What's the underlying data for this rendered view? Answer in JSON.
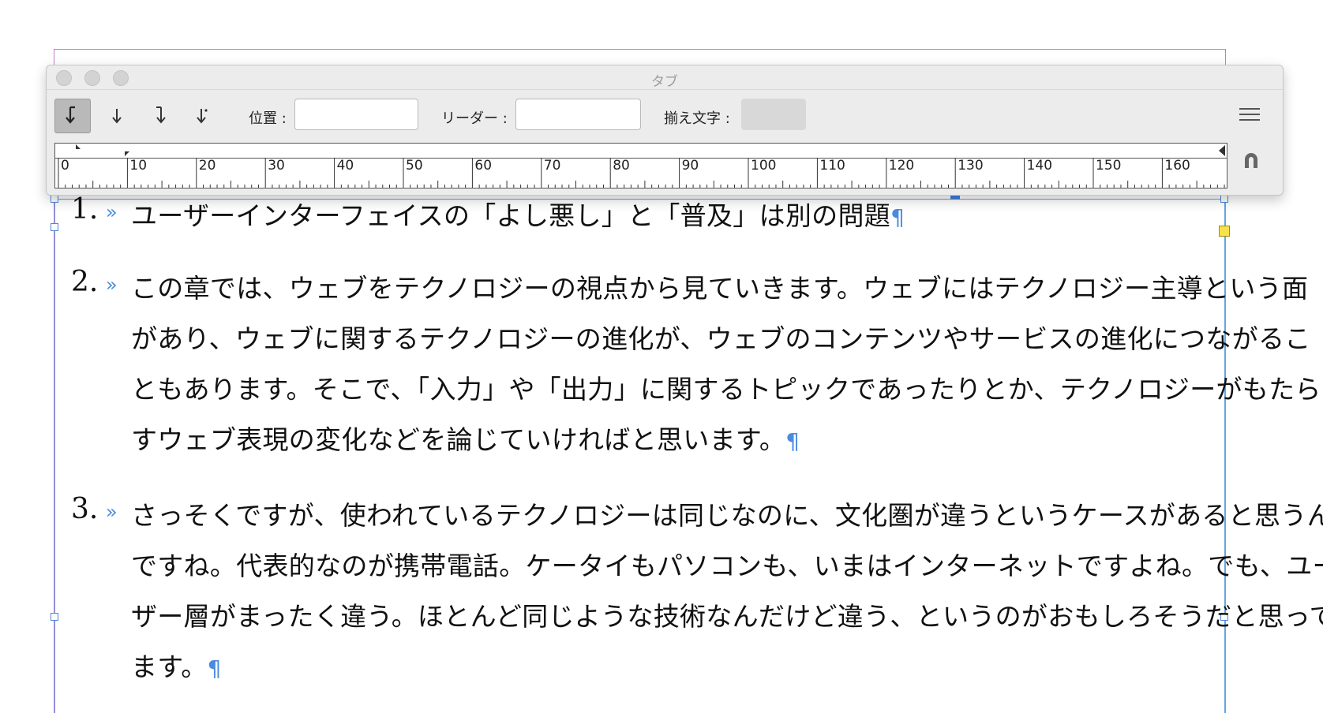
{
  "document": {
    "paragraphs": [
      {
        "number": "1.",
        "lines": [
          "ユーザーインターフェイスの「よし悪し」と「普及」は別の問題"
        ]
      },
      {
        "number": "2.",
        "lines": [
          "この章では、ウェブをテクノロジーの視点から見ていきます。ウェブにはテクノロジー主導という面",
          "があり、ウェブに関するテクノロジーの進化が、ウェブのコンテンツやサービスの進化につながるこ",
          "ともあります。そこで、「入力」や「出力」に関するトピックであったりとか、テクノロジーがもたら",
          "すウェブ表現の変化などを論じていければと思います。"
        ]
      },
      {
        "number": "3.",
        "lines": [
          "さっそくですが、使われているテクノロジーは同じなのに、文化圏が違うというケースがあると思うん",
          "ですね。代表的なのが携帯電話。ケータイもパソコンも、いまはインターネットですよね。でも、ユー",
          "ザー層がまったく違う。ほとんど同じような技術なんだけど違う、というのがおもしろそうだと思ってい",
          "ます。"
        ]
      }
    ],
    "tab_mark": "»",
    "pilcrow": "¶"
  },
  "panel": {
    "title": "タブ",
    "position_label": "位置 :",
    "position_value": "",
    "leader_label": "リーダー :",
    "leader_value": "",
    "align_label": "揃え文字 :",
    "align_value": "",
    "tab_buttons": [
      {
        "name": "left-tab",
        "glyph": "↓",
        "active": true
      },
      {
        "name": "center-tab",
        "glyph": "↓",
        "active": false
      },
      {
        "name": "right-tab",
        "glyph": "↓",
        "active": false
      },
      {
        "name": "decimal-tab",
        "glyph": "↓",
        "active": false
      }
    ],
    "ruler_labels": [
      "0",
      "10",
      "20",
      "30",
      "40",
      "50",
      "60",
      "70",
      "80",
      "90",
      "100",
      "110",
      "120",
      "130",
      "140",
      "150",
      "160"
    ]
  },
  "colors": {
    "accent_blue": "#4a8be0",
    "margin_guide": "#c77ac9",
    "panel_bg": "#ececec"
  }
}
